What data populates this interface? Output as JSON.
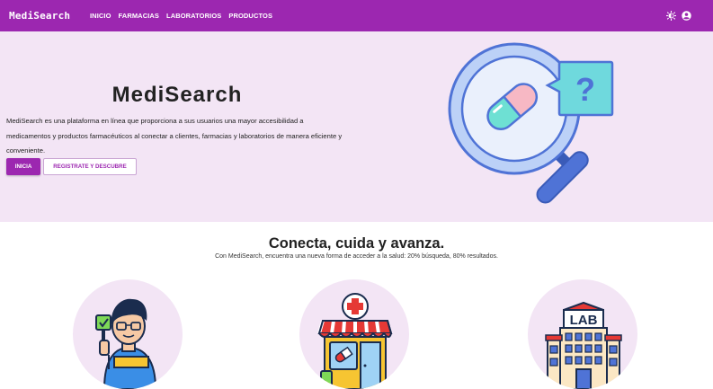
{
  "navbar": {
    "brand": "MediSearch",
    "links": [
      "INICIO",
      "FARMACIAS",
      "LABORATORIOS",
      "PRODUCTOS"
    ],
    "icons": [
      "theme-toggle-icon",
      "user-account-icon"
    ]
  },
  "hero": {
    "title": "MediSearch",
    "description": "MediSearch es una plataforma en línea que proporciona a sus usuarios una mayor accesibilidad a medicamentos y productos farmacéuticos al conectar a clientes, farmacias y laboratorios de manera eficiente y conveniente.",
    "primary_button": "INICIA",
    "secondary_button": "REGISTRATE Y DESCUBRE",
    "illustration": "magnifier-pill-question-icon"
  },
  "features": {
    "title": "Conecta, cuida y avanza.",
    "subtitle": "Con MediSearch, encuentra una nueva forma de acceder a la salud: 20% búsqueda, 80% resultados.",
    "items": [
      {
        "icon": "customer-approval-icon"
      },
      {
        "icon": "pharmacy-store-icon"
      },
      {
        "icon": "laboratory-building-icon",
        "sign": "LAB"
      }
    ]
  },
  "colors": {
    "primary": "#9c27b0",
    "hero_background": "#f3e5f5"
  }
}
